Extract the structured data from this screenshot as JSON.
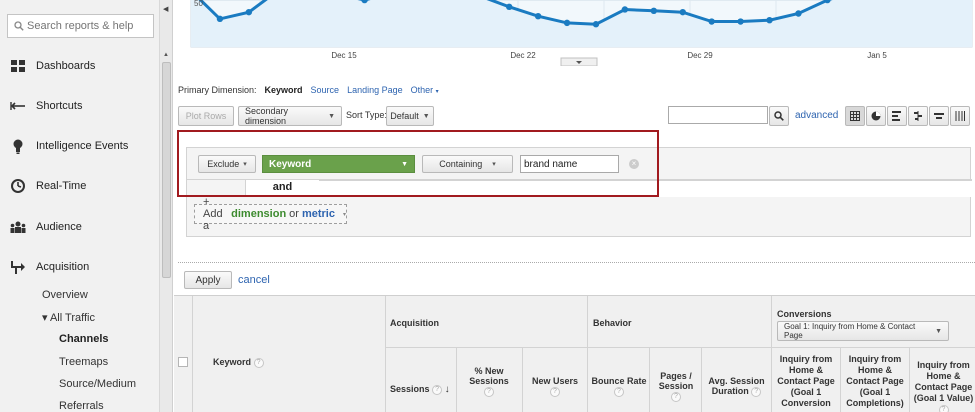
{
  "sidebar": {
    "search_placeholder": "Search reports & help",
    "items": [
      {
        "label": "Dashboards"
      },
      {
        "label": "Shortcuts"
      },
      {
        "label": "Intelligence Events"
      },
      {
        "label": "Real-Time"
      },
      {
        "label": "Audience"
      },
      {
        "label": "Acquisition"
      }
    ],
    "sub": {
      "overview": "Overview",
      "all_traffic": "▾ All Traffic",
      "channels": "Channels",
      "treemaps": "Treemaps",
      "source_medium": "Source/Medium",
      "referrals": "Referrals"
    }
  },
  "chart_data": {
    "type": "line",
    "title": "",
    "ytick_label": "50",
    "x_ticks": [
      "Dec 15",
      "Dec 22",
      "Dec 29",
      "Jan 5"
    ],
    "series": [
      {
        "values": [
          62,
          41,
          46,
          null,
          62,
          60,
          55,
          61,
          62,
          null,
          58,
          50,
          43,
          38,
          37,
          48,
          47,
          46,
          39,
          39,
          40,
          45,
          55,
          62,
          61,
          62,
          61,
          60
        ]
      }
    ],
    "colors": {
      "line": "#1a7bc1",
      "fill": "#e4f1fa"
    }
  },
  "primary_dimension": {
    "label": "Primary Dimension:",
    "current": "Keyword",
    "options": [
      "Source",
      "Landing Page",
      "Other"
    ]
  },
  "toolbar": {
    "plot_rows": "Plot Rows",
    "secondary_dimension": "Secondary dimension",
    "sort_type_label": "Sort Type:",
    "sort_value": "Default",
    "search_value": "",
    "advanced": "advanced"
  },
  "filter": {
    "mode": "Exclude",
    "dimension": "Keyword",
    "match": "Containing",
    "value": "brand name",
    "and_label": "and"
  },
  "add_dimension": {
    "prefix": "+ Add a",
    "dimension": "dimension",
    "or": "or",
    "metric": "metric"
  },
  "actions": {
    "apply": "Apply",
    "cancel": "cancel"
  },
  "table": {
    "keyword_header": "Keyword",
    "groups": {
      "acquisition": "Acquisition",
      "behavior": "Behavior",
      "conversions": "Conversions"
    },
    "goal_select": "Goal 1: Inquiry from Home & Contact Page",
    "columns": {
      "sessions": "Sessions",
      "pct_new_sessions": "% New Sessions",
      "new_users": "New Users",
      "bounce_rate": "Bounce Rate",
      "pages_session": "Pages / Session",
      "avg_session": "Avg. Session Duration",
      "goal_conversion": "Inquiry from Home & Contact Page (Goal 1 Conversion",
      "goal_completions": "Inquiry from Home & Contact Page (Goal 1 Completions)",
      "goal_value": "Inquiry from Home & Contact Page (Goal 1 Value)"
    }
  }
}
